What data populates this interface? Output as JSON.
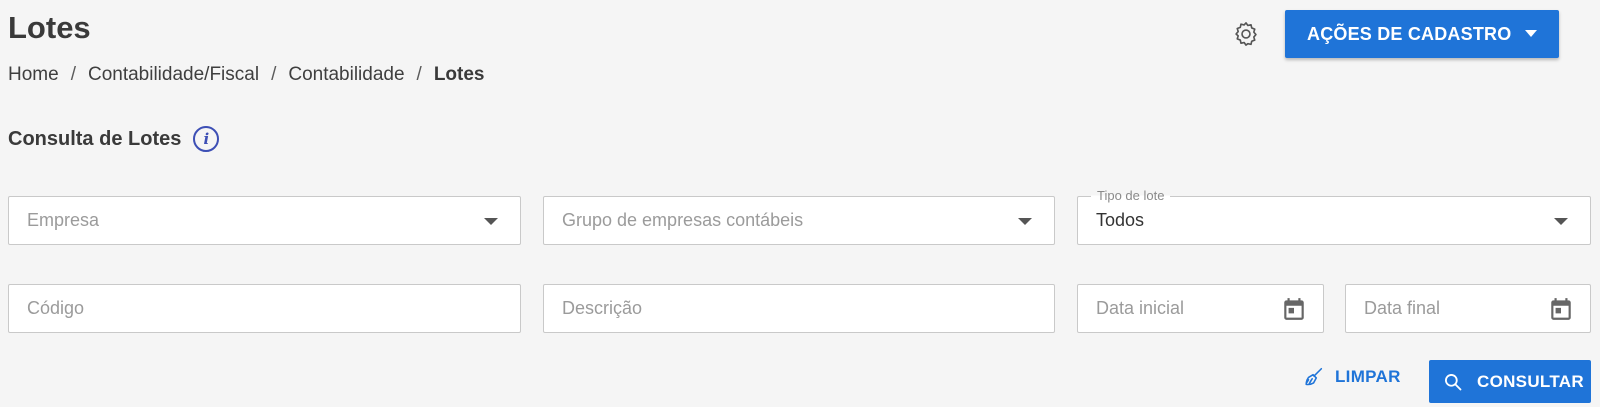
{
  "header": {
    "title": "Lotes",
    "breadcrumb": [
      "Home",
      "Contabilidade/Fiscal",
      "Contabilidade",
      "Lotes"
    ],
    "separator": "/",
    "actions_label": "AÇÕES DE CADASTRO",
    "settings_icon": "gear-icon"
  },
  "section": {
    "title": "Consulta de Lotes",
    "info_icon": "info-icon",
    "info_glyph": "i"
  },
  "filters": {
    "empresa": {
      "placeholder": "Empresa"
    },
    "grupo": {
      "placeholder": "Grupo de empresas contábeis"
    },
    "tipo_lote": {
      "label": "Tipo de lote",
      "value": "Todos"
    },
    "codigo": {
      "placeholder": "Código"
    },
    "descricao": {
      "placeholder": "Descrição"
    },
    "data_inicial": {
      "placeholder": "Data inicial"
    },
    "data_final": {
      "placeholder": "Data final"
    }
  },
  "buttons": {
    "clear_label": "LIMPAR",
    "search_label": "CONSULTAR"
  },
  "colors": {
    "primary": "#1f74d8",
    "info": "#3d4fb5",
    "background": "#f5f5f5"
  }
}
